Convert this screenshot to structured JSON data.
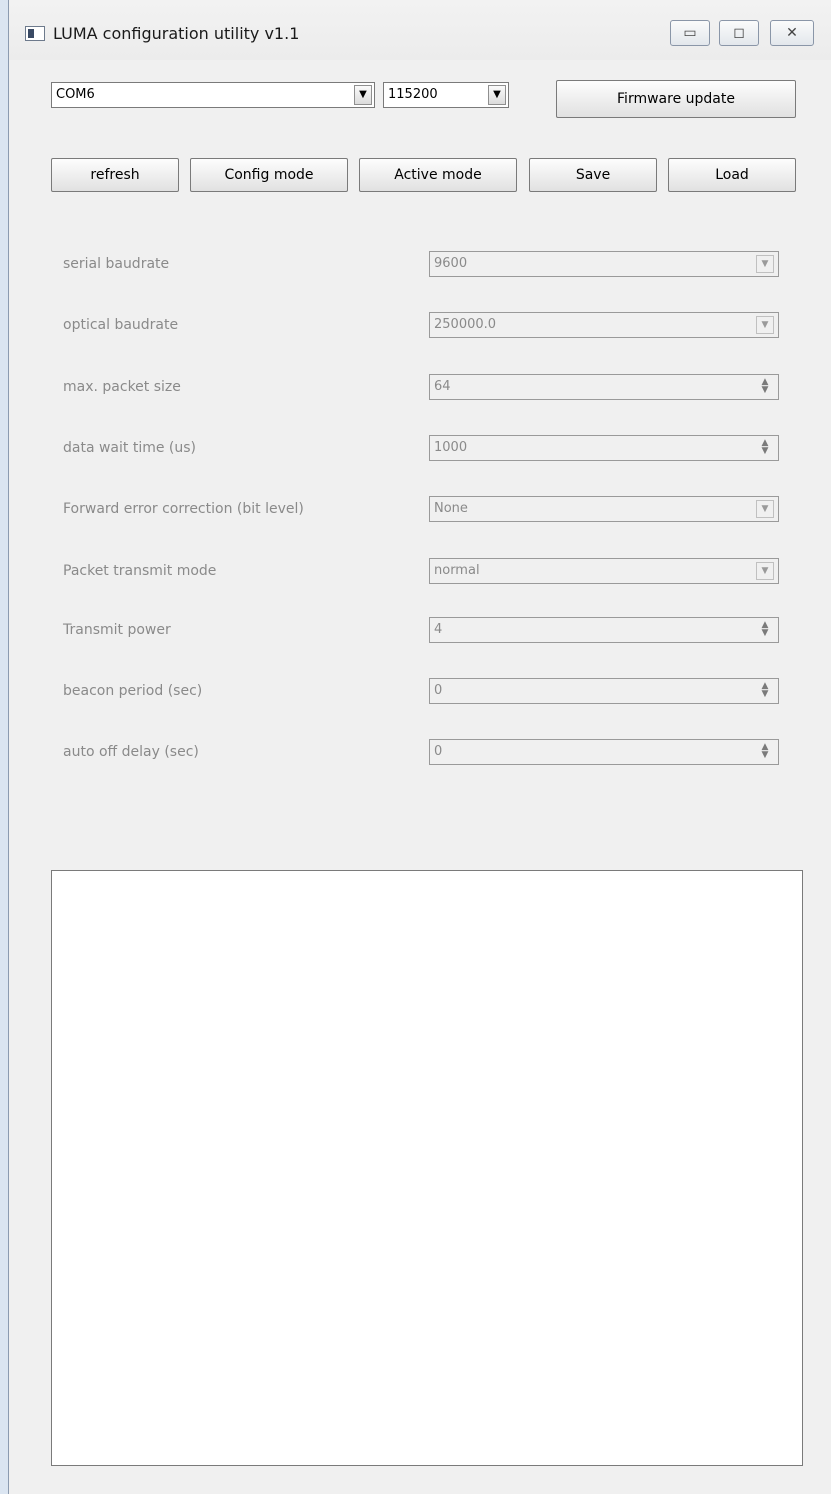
{
  "window": {
    "title": "LUMA configuration utility v1.1"
  },
  "top": {
    "port": "COM6",
    "baud": "115200",
    "firmware_label": "Firmware update"
  },
  "actions": {
    "refresh": "refresh",
    "config": "Config mode",
    "active": "Active mode",
    "save": "Save",
    "load": "Load"
  },
  "settings": [
    {
      "label": "serial baudrate",
      "value": "9600",
      "control": "dropdown"
    },
    {
      "label": "optical baudrate",
      "value": "250000.0",
      "control": "dropdown"
    },
    {
      "label": "max. packet size",
      "value": "64",
      "control": "spinner"
    },
    {
      "label": "data wait time (us)",
      "value": "1000",
      "control": "spinner"
    },
    {
      "label": "Forward error correction (bit level)",
      "value": "None",
      "control": "dropdown"
    },
    {
      "label": "Packet transmit mode",
      "value": "normal",
      "control": "dropdown"
    },
    {
      "label": "Transmit power",
      "value": "4",
      "control": "spinner"
    },
    {
      "label": "beacon period (sec)",
      "value": "0",
      "control": "spinner"
    },
    {
      "label": "auto off delay (sec)",
      "value": "0",
      "control": "spinner"
    }
  ]
}
